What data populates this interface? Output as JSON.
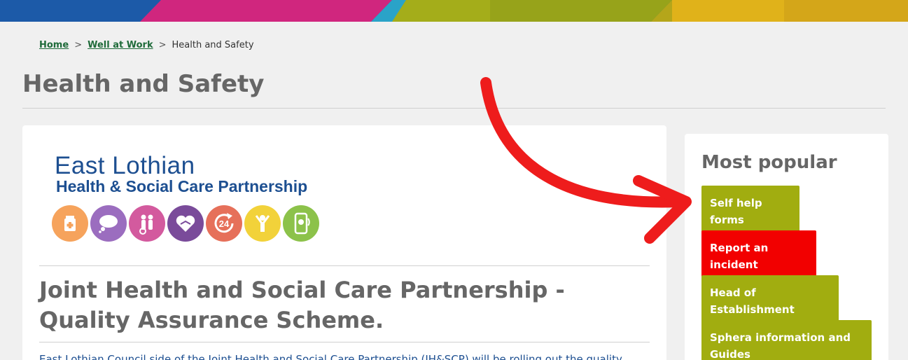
{
  "colors": {
    "accent_green": "#a1ad10",
    "alert_red": "#f20000",
    "link_green": "#1f6b3a",
    "logo_blue": "#1d4f91",
    "arrow_red": "#ee1c1c"
  },
  "breadcrumb": {
    "items": [
      {
        "label": "Home"
      },
      {
        "label": "Well at Work"
      }
    ],
    "current": "Health and Safety",
    "separator": ">"
  },
  "page": {
    "title": "Health and Safety"
  },
  "main": {
    "logo": {
      "line1": "East Lothian",
      "line2": "Health & Social Care Partnership",
      "icons": [
        "medicine-icon",
        "thought-bubble-icon",
        "family-icon",
        "heart-handshake-icon",
        "24-hours-icon",
        "celebration-icon",
        "phone-icon"
      ],
      "icon_number": "24"
    },
    "heading": "Joint Health and Social Care Partnership - Quality Assurance Scheme.",
    "intro": "East Lothian Council side of the Joint Health and Social Care Partnership (JH&SCP) will be rolling out the quality"
  },
  "sidebar": {
    "title": "Most popular",
    "links": [
      {
        "label": "Self help forms"
      },
      {
        "label": "Report an incident"
      },
      {
        "label": "Head of Establishment"
      },
      {
        "label": "Sphera information and Guides"
      }
    ]
  }
}
